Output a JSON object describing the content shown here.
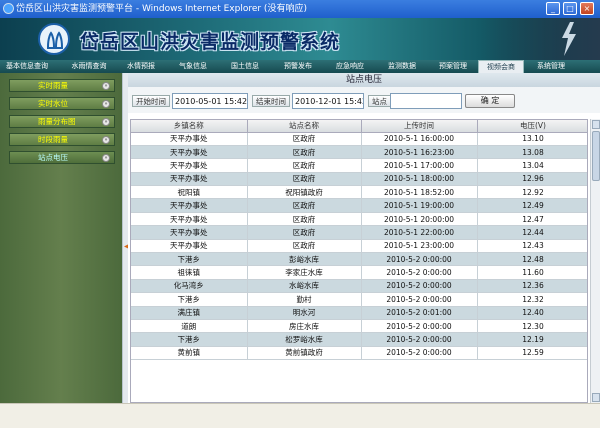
{
  "window": {
    "title": "岱岳区山洪灾害监测预警平台 - Windows Internet Explorer (没有响应)",
    "min": "_",
    "max": "□",
    "close": "×"
  },
  "banner": {
    "title": "岱岳区山洪灾害监测预警系统"
  },
  "nav": {
    "items": [
      {
        "label": "基本信息查询",
        "active": false
      },
      {
        "label": "水雨情查询",
        "active": false
      },
      {
        "label": "水情预报",
        "active": false
      },
      {
        "label": "气象信息",
        "active": false
      },
      {
        "label": "国土信息",
        "active": false
      },
      {
        "label": "预警发布",
        "active": false
      },
      {
        "label": "应急响应",
        "active": false
      },
      {
        "label": "监测数据",
        "active": false
      },
      {
        "label": "预案管理",
        "active": false
      },
      {
        "label": "视频会商",
        "active": true
      },
      {
        "label": "系统管理",
        "active": false
      }
    ]
  },
  "sidebar": {
    "items": [
      {
        "label": "实时雨量"
      },
      {
        "label": "实时水位"
      },
      {
        "label": "雨量分布图"
      },
      {
        "label": "时段雨量"
      },
      {
        "label": "站点电压"
      }
    ]
  },
  "main": {
    "title": "站点电压",
    "filter": {
      "start_label": "开始时间",
      "start_value": "2010-05-01 15:42:21",
      "end_label": "结束时间",
      "end_value": "2010-12-01 15:42:21",
      "station_label": "站点",
      "station_value": "",
      "ok_label": "确 定"
    },
    "table": {
      "headers": [
        "乡镇名称",
        "站点名称",
        "上传时间",
        "电压(V)"
      ],
      "rows": [
        [
          "天平办事处",
          "区政府",
          "2010-5-1 16:00:00",
          "13.10"
        ],
        [
          "天平办事处",
          "区政府",
          "2010-5-1 16:23:00",
          "13.08"
        ],
        [
          "天平办事处",
          "区政府",
          "2010-5-1 17:00:00",
          "13.04"
        ],
        [
          "天平办事处",
          "区政府",
          "2010-5-1 18:00:00",
          "12.96"
        ],
        [
          "祝阳镇",
          "祝阳镇政府",
          "2010-5-1 18:52:00",
          "12.92"
        ],
        [
          "天平办事处",
          "区政府",
          "2010-5-1 19:00:00",
          "12.49"
        ],
        [
          "天平办事处",
          "区政府",
          "2010-5-1 20:00:00",
          "12.47"
        ],
        [
          "天平办事处",
          "区政府",
          "2010-5-1 22:00:00",
          "12.44"
        ],
        [
          "天平办事处",
          "区政府",
          "2010-5-1 23:00:00",
          "12.43"
        ],
        [
          "下港乡",
          "彭峪水库",
          "2010-5-2 0:00:00",
          "12.48"
        ],
        [
          "祖徕镇",
          "李家庄水库",
          "2010-5-2 0:00:00",
          "11.60"
        ],
        [
          "化马湾乡",
          "水峪水库",
          "2010-5-2 0:00:00",
          "12.36"
        ],
        [
          "下港乡",
          "勤村",
          "2010-5-2 0:00:00",
          "12.32"
        ],
        [
          "满庄镇",
          "明水河",
          "2010-5-2 0:01:00",
          "12.40"
        ],
        [
          "道朗",
          "房庄水库",
          "2010-5-2 0:00:00",
          "12.30"
        ],
        [
          "下港乡",
          "松罗峪水库",
          "2010-5-2 0:00:00",
          "12.19"
        ],
        [
          "黄前镇",
          "黄前镇政府",
          "2010-5-2 0:00:00",
          "12.59"
        ]
      ]
    }
  }
}
